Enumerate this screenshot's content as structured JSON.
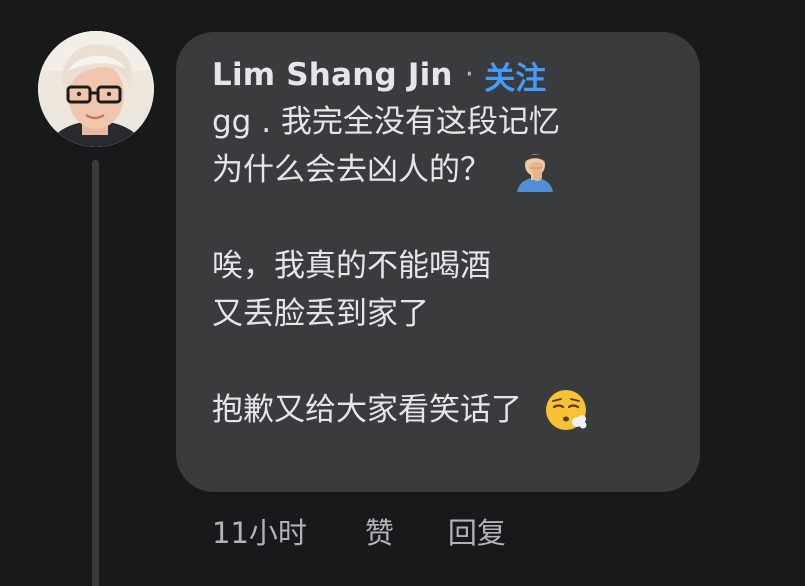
{
  "comment": {
    "author": "Lim Shang Jin",
    "separator": "·",
    "follow_label": "关注",
    "lines": [
      "gg . 我完全没有这段记忆",
      "为什么会去凶人的？",
      "",
      "唉，我真的不能喝酒",
      "又丢脸丢到家了",
      "",
      "抱歉又给大家看笑话了"
    ],
    "emojis": {
      "line_2": "man-facepalming-icon",
      "line_7": "face-exhaling-icon"
    }
  },
  "meta": {
    "time": "11小时",
    "like_label": "赞",
    "reply_label": "回复"
  },
  "colors": {
    "background": "#18191a",
    "bubble": "#3a3b3c",
    "text": "#e4e6eb",
    "secondary_text": "#b0b3b8",
    "link": "#4599ff"
  }
}
